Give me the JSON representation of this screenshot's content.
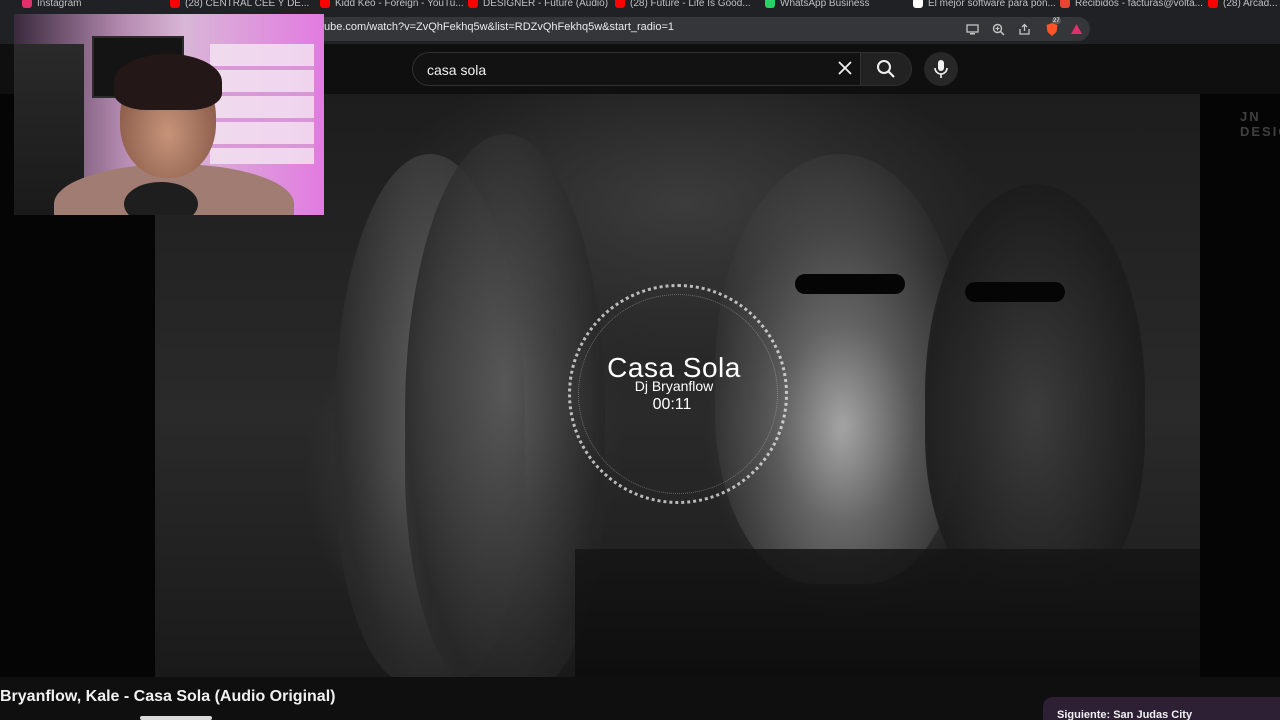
{
  "browser": {
    "bookmarks": [
      {
        "label": "Instagram",
        "color": "#e1306c"
      },
      {
        "label": "(28) CENTRAL CEE Y DE...",
        "color": "#ff0000"
      },
      {
        "label": "Kidd Keo - Foreign - YouTu...",
        "color": "#ff0000"
      },
      {
        "label": "DESIGNER - Future (Audio)",
        "color": "#ff0000"
      },
      {
        "label": "(28) Future - Life Is Good...",
        "color": "#ff0000"
      },
      {
        "label": "WhatsApp Business",
        "color": "#25d366"
      },
      {
        "label": "El mejor software para pon...",
        "color": "#ffffff"
      },
      {
        "label": "Recibidos - facturas@volta...",
        "color": "#ea4335"
      },
      {
        "label": "(28) Arcad...",
        "color": "#ff0000"
      }
    ],
    "url": "ube.com/watch?v=ZvQhFekhq5w&list=RDZvQhFekhq5w&start_radio=1",
    "brave_badge": "27"
  },
  "header": {
    "search_value": "casa sola"
  },
  "video": {
    "song_title": "Casa Sola",
    "song_artist": "Dj Bryanflow",
    "timestamp": "00:11",
    "watermark": "JN DESIGN"
  },
  "page": {
    "video_title": "Bryanflow, Kale - Casa Sola (Audio Original)",
    "next_up": "Siguiente: San Judas City"
  }
}
